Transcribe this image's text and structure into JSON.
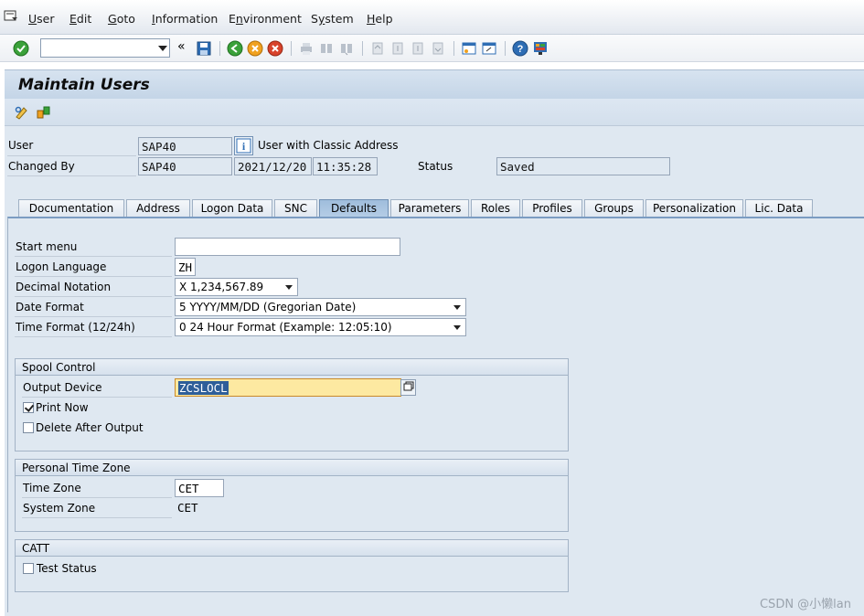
{
  "menu": [
    "User",
    "Edit",
    "Goto",
    "Information",
    "Environment",
    "System",
    "Help"
  ],
  "menu_underline": [
    "U",
    "E",
    "G",
    "I",
    "n",
    "y",
    "H"
  ],
  "command_field": {
    "value": ""
  },
  "title": "Maintain Users",
  "header": {
    "user_label": "User",
    "user_value": "SAP40",
    "user_desc": "User with Classic Address",
    "changed_by_label": "Changed By",
    "changed_by_value": "SAP40",
    "changed_date": "2021/12/20",
    "changed_time": "11:35:28",
    "status_label": "Status",
    "status_value": "Saved"
  },
  "tabs": [
    "Documentation",
    "Address",
    "Logon Data",
    "SNC",
    "Defaults",
    "Parameters",
    "Roles",
    "Profiles",
    "Groups",
    "Personalization",
    "Lic. Data"
  ],
  "active_tab": "Defaults",
  "defaults": {
    "start_menu_label": "Start menu",
    "start_menu_value": "",
    "logon_language_label": "Logon Language",
    "logon_language_value": "ZH",
    "decimal_notation_label": "Decimal Notation",
    "decimal_notation_value": "X 1,234,567.89",
    "date_format_label": "Date Format",
    "date_format_value": "5 YYYY/MM/DD (Gregorian Date)",
    "time_format_label": "Time Format (12/24h)",
    "time_format_value": "0 24 Hour Format (Example: 12:05:10)"
  },
  "spool": {
    "title": "Spool Control",
    "output_device_label": "Output Device",
    "output_device_value": "ZCSLOCL",
    "print_now_label": "Print Now",
    "print_now_checked": true,
    "delete_after_label": "Delete After Output",
    "delete_after_checked": false
  },
  "timezone": {
    "title": "Personal Time Zone",
    "time_zone_label": "Time Zone",
    "time_zone_value": "CET",
    "system_zone_label": "System Zone",
    "system_zone_value": "CET"
  },
  "catt": {
    "title": "CATT",
    "test_status_label": "Test Status",
    "test_status_checked": false
  },
  "watermark": "CSDN @小懒lan",
  "colors": {
    "accent": "#7b9cc2",
    "highlight": "#fde9a1",
    "background": "#dfe8f1"
  }
}
